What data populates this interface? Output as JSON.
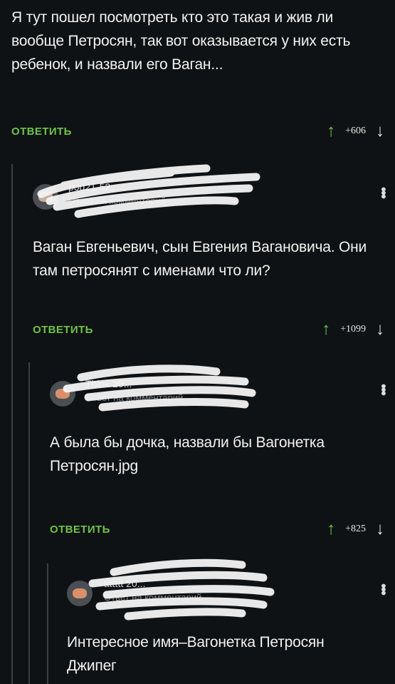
{
  "comments": [
    {
      "text": "Я тут пошел посмотреть кто это такая и жив ли вообще Петросян, так вот оказывается у них есть ребенок, и назвали его Ваган...",
      "reply_label": "ОТВЕТИТЬ",
      "rating": "+606"
    },
    {
      "author": "pod21-52...",
      "reply_hint": "Ответ на комментарий",
      "text": "Ваган Евгеньевич, сын Евгения Вагановича. Они там петросянят с именами что ли?",
      "reply_label": "ОТВЕТИТЬ",
      "rating": "+1099"
    },
    {
      "author": "Think 20...",
      "reply_hint": "Ответ на комментарий",
      "text": "А была бы дочка, назвали бы Вагонетка Петросян.jpg",
      "reply_label": "ОТВЕТИТЬ",
      "rating": "+825"
    },
    {
      "author": "ttttttt 20...",
      "reply_hint": "Ответ на комментарий",
      "text": "Интересное имя–Вагонетка Петросян Джипег"
    }
  ],
  "icons": {
    "upvote": "arrow-up-icon",
    "downvote": "arrow-down-icon",
    "more": "more-vertical-icon"
  },
  "colors": {
    "background": "#0f1214",
    "accent": "#6ec24a",
    "text": "#f2f2f2"
  }
}
